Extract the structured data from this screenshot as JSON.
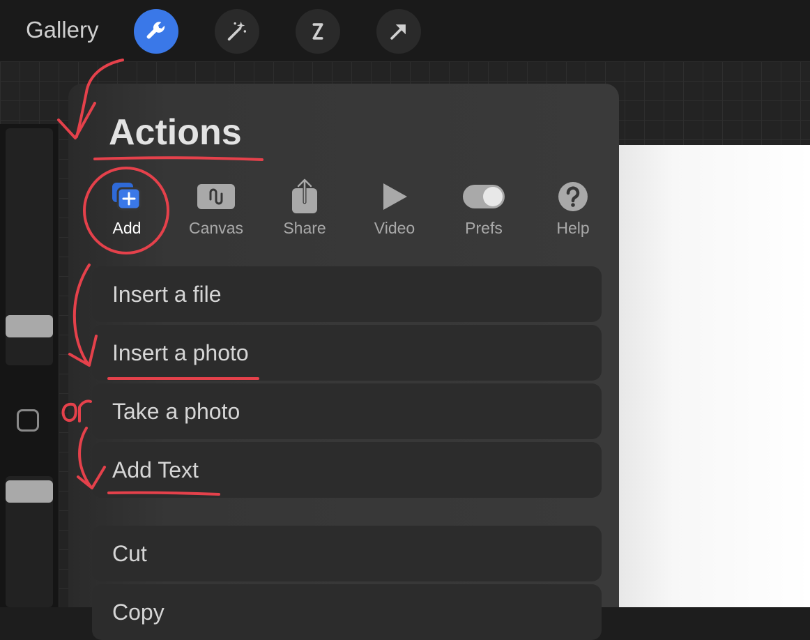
{
  "topbar": {
    "gallery_label": "Gallery",
    "tools": [
      {
        "name": "actions-wrench",
        "active": true
      },
      {
        "name": "adjustments-magic-wand",
        "active": false
      },
      {
        "name": "selection",
        "active": false
      },
      {
        "name": "transform-arrow",
        "active": false
      }
    ]
  },
  "panel": {
    "title": "Actions",
    "tabs": [
      {
        "label": "Add",
        "icon": "add-layers-icon",
        "active": true
      },
      {
        "label": "Canvas",
        "icon": "canvas-icon",
        "active": false
      },
      {
        "label": "Share",
        "icon": "share-icon",
        "active": false
      },
      {
        "label": "Video",
        "icon": "play-icon",
        "active": false
      },
      {
        "label": "Prefs",
        "icon": "toggle-icon",
        "active": false
      },
      {
        "label": "Help",
        "icon": "help-icon",
        "active": false
      }
    ],
    "menu_items": [
      "Insert a file",
      "Insert a photo",
      "Take a photo",
      "Add Text",
      "Cut",
      "Copy"
    ]
  },
  "annotation": {
    "or_label": "or",
    "color": "#e5414b"
  },
  "colors": {
    "accent": "#3a78e8",
    "panel": "#383838",
    "menu_item": "#2c2c2c",
    "annotation": "#e5414b"
  }
}
